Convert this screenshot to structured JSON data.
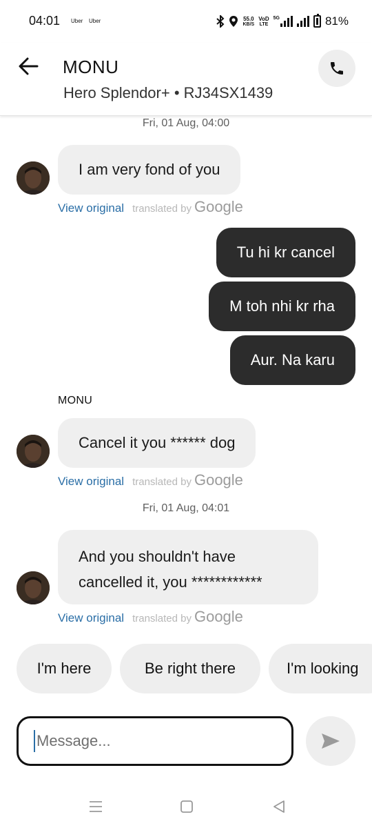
{
  "status_bar": {
    "time": "04:01",
    "app_badges": [
      "Uber",
      "Uber"
    ],
    "network_speed": "55.0",
    "network_speed_unit": "KB/S",
    "volte_top": "VoD",
    "volte_bottom": "LTE",
    "network_type": "5G",
    "battery": "81%"
  },
  "header": {
    "name": "MONU",
    "vehicle": "Hero Splendor+ • RJ34SX1439",
    "icons": {
      "back": "arrow-left-icon",
      "call": "phone-icon"
    }
  },
  "chat": {
    "date_1": "Fri, 01 Aug, 04:00",
    "date_2": "Fri, 01 Aug, 04:01",
    "sender_label": "MONU",
    "incoming": [
      {
        "text": "I am very fond of you"
      },
      {
        "text": "Cancel it you ****** dog"
      },
      {
        "line1": "And you shouldn't have",
        "line2": "cancelled it, you ************"
      }
    ],
    "outgoing": [
      {
        "text": "Tu hi kr cancel"
      },
      {
        "text": "M toh nhi kr rha"
      },
      {
        "text": "Aur. Na karu"
      }
    ],
    "view_original": "View original",
    "translated_by": "translated by",
    "google": "Google"
  },
  "quick_replies": [
    "I'm here",
    "Be right there",
    "I'm looking"
  ],
  "composer": {
    "placeholder": "Message...",
    "icons": {
      "send": "send-icon"
    }
  },
  "nav": {
    "icons": [
      "menu-icon",
      "home-icon",
      "back-icon"
    ]
  },
  "colors": {
    "incoming_bubble": "#efefef",
    "outgoing_bubble": "#2c2c2c",
    "link": "#2a6ea6"
  }
}
